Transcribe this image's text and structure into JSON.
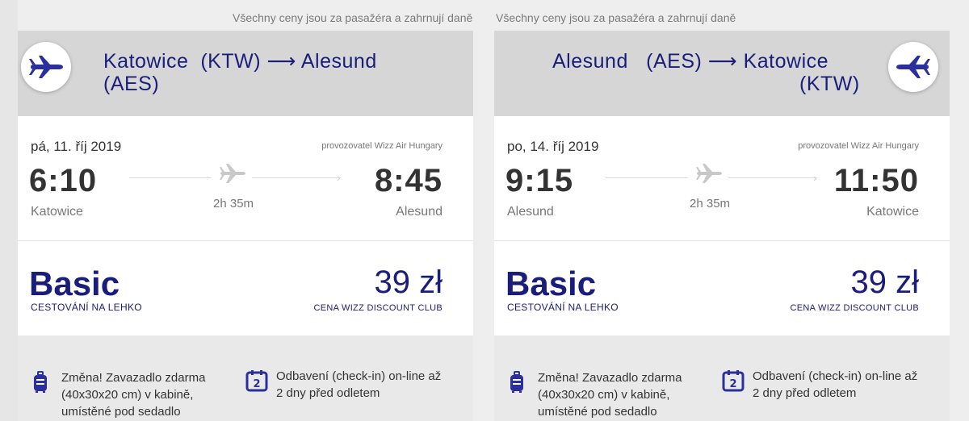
{
  "outbound": {
    "note": "Všechny ceny jsou za pasažéra a zahrnují daně",
    "route_line1": "Katowice  (KTW) ⟶ Alesund",
    "route_line2": "(AES)",
    "date": "pá, 11. říj 2019",
    "operator": "provozovatel Wizz Air Hungary",
    "departure_time": "6:10",
    "arrival_time": "8:45",
    "departure_city": "Katowice",
    "arrival_city": "Alesund",
    "duration": "2h 35m",
    "fare_name": "Basic",
    "fare_subtitle": "CESTOVÁNÍ NA LEHKO",
    "price": "39 zł",
    "price_note": "CENA WIZZ DISCOUNT CLUB",
    "feature1": "Změna! Zavazadlo zdarma (40x30x20 cm) v kabině, umístěné pod sedadlo",
    "feature2": "Odbavení (check-in) on-line až 2 dny před odletem",
    "feature2_badge": "2"
  },
  "return": {
    "note": "Všechny ceny jsou za pasažéra a zahrnují daně",
    "route_line1": "Alesund   (AES) ⟶ Katowice",
    "route_line2": "(KTW)",
    "date": "po, 14. říj 2019",
    "operator": "provozovatel Wizz Air Hungary",
    "departure_time": "9:15",
    "arrival_time": "11:50",
    "departure_city": "Alesund",
    "arrival_city": "Katowice",
    "duration": "2h 35m",
    "fare_name": "Basic",
    "fare_subtitle": "CESTOVÁNÍ NA LEHKO",
    "price": "39 zł",
    "price_note": "CENA WIZZ DISCOUNT CLUB",
    "feature1": "Změna! Zavazadlo zdarma (40x30x20 cm) v kabině, umístěné pod sedadlo",
    "feature2": "Odbavení (check-in) on-line až 2 dny před odletem",
    "feature2_badge": "2"
  },
  "colors": {
    "brand": "#1a1d7a",
    "header_bg": "#d6d6d6",
    "features_bg": "#e9e9e9"
  },
  "icons": [
    "plane-outbound-icon",
    "plane-return-icon",
    "plane-flight-icon",
    "luggage-icon",
    "calendar-icon"
  ]
}
